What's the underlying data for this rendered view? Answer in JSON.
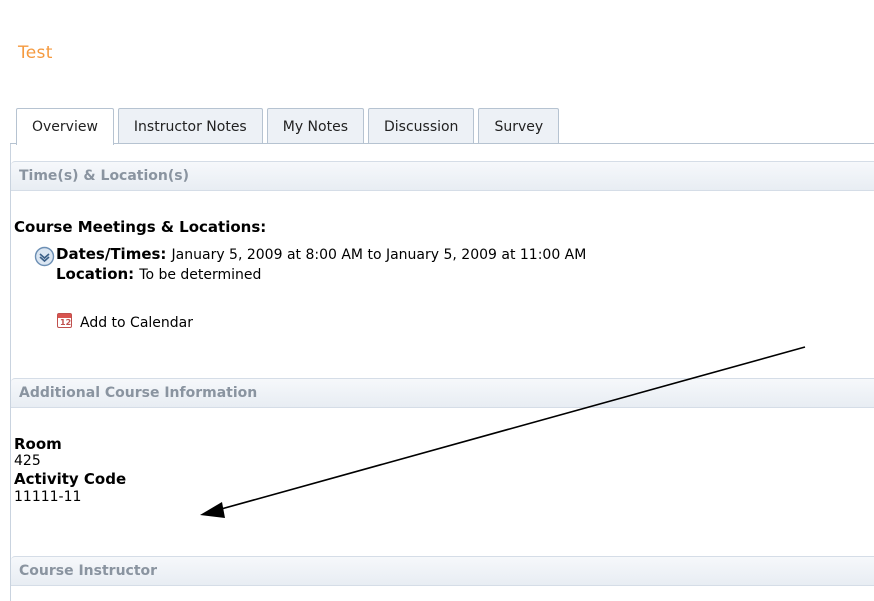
{
  "header": {
    "title": "Test"
  },
  "tabs": [
    "Overview",
    "Instructor Notes",
    "My Notes",
    "Discussion",
    "Survey"
  ],
  "time_location": {
    "section_title": "Time(s) & Location(s)",
    "meetings_label": "Course Meetings & Locations:",
    "dates_label": "Dates/Times:",
    "dates_value": "January 5, 2009 at 8:00 AM to January 5, 2009 at 11:00 AM",
    "location_label": "Location:",
    "location_value": "To be determined",
    "calendar_link": "Add to Calendar",
    "calendar_icon_day": "12"
  },
  "additional": {
    "section_title": "Additional Course Information",
    "room_label": "Room",
    "room_value": "425",
    "activity_label": "Activity Code",
    "activity_value": "11111-11"
  },
  "instructor": {
    "section_title": "Course Instructor"
  }
}
